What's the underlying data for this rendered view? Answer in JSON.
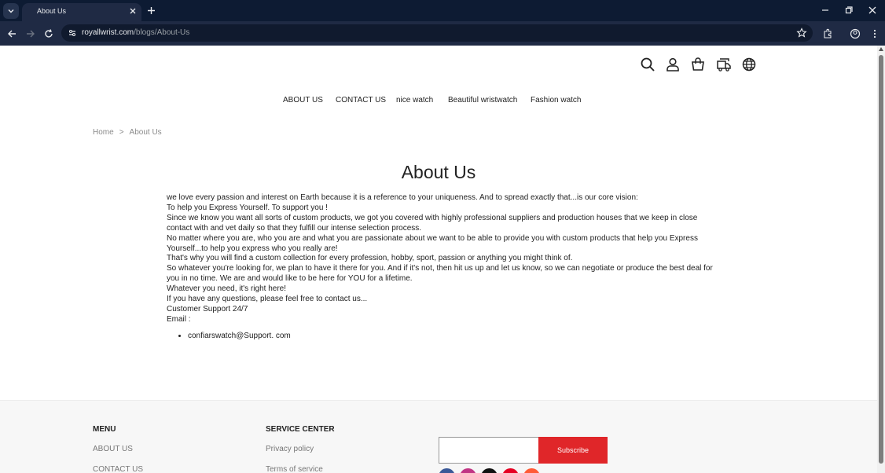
{
  "browser": {
    "tab_title": "About Us",
    "url_host": "royallwrist.com",
    "url_path": "/blogs/About-Us"
  },
  "nav": {
    "items": [
      "ABOUT US",
      "CONTACT US",
      "nice watch",
      "Beautiful wristwatch",
      "Fashion watch"
    ]
  },
  "breadcrumb": {
    "home": "Home",
    "sep": ">",
    "current": "About Us"
  },
  "page": {
    "title": "About Us",
    "paragraphs": [
      "we love every passion and interest on Earth because it is a reference to your uniqueness. And to spread exactly that...is our core vision:",
      "To help you Express Yourself. To support you !",
      "Since we know you want all sorts of custom products, we got you covered with highly professional suppliers and production houses that we keep in close contact with and vet daily so that they fulfill our intense selection process.",
      "No matter where you are, who you are and what you are passionate about we want to be able to provide you with custom products that help you Express Yourself...to help you express who you really are!",
      "That's why you will find a custom collection for every profession, hobby, sport, passion or anything you might think of.",
      "So whatever you're looking for, we plan to have it there for you. And if it's not, then hit us up and let us know, so we can negotiate or produce the best deal for you in no time. We are and would like to be here for YOU for a lifetime.",
      "Whatever you need, it's right here!",
      "If you have any questions, please feel free to contact us...",
      "Customer Support 24/7",
      "Email :"
    ],
    "email_item": "confiarswatch@Support. com"
  },
  "footer": {
    "menu_title": "MENU",
    "menu_links": [
      "ABOUT US",
      "CONTACT US"
    ],
    "service_title": "SERVICE CENTER",
    "service_links": [
      "Privacy policy",
      "Terms of service"
    ],
    "subscribe_label": "Subscribe"
  },
  "colors": {
    "accent": "#e02629",
    "chrome": "#1f2a44",
    "social": [
      "#3b5998",
      "#c13584",
      "#111111",
      "#e60023",
      "#ff5a36"
    ]
  }
}
